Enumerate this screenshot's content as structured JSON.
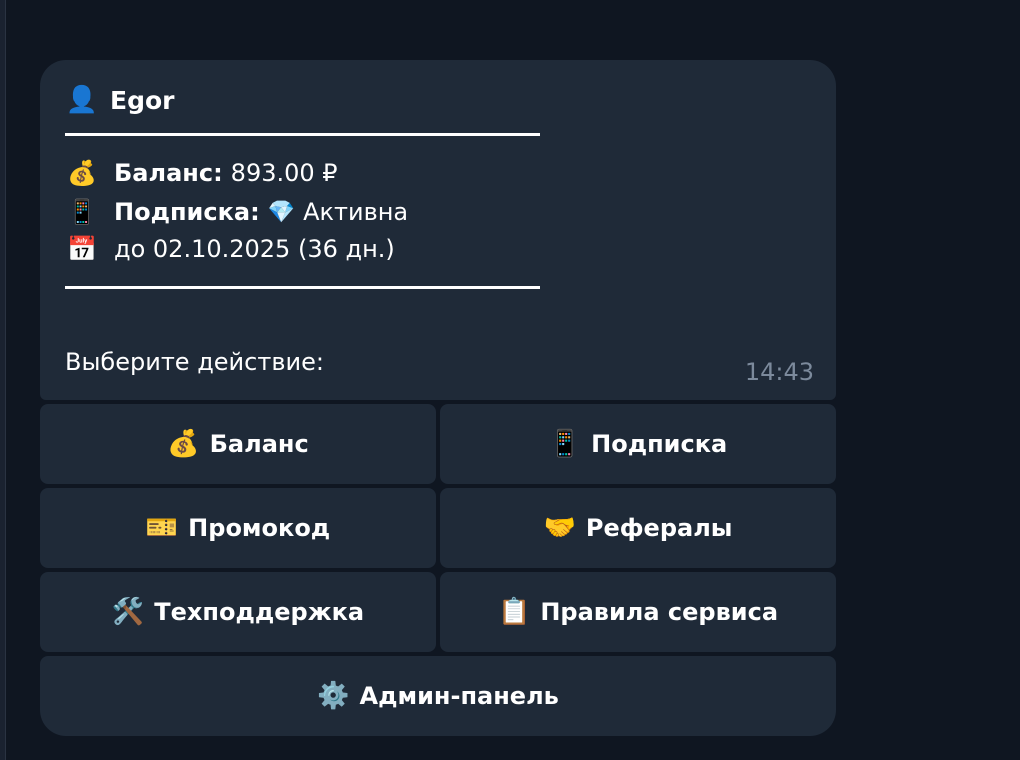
{
  "message": {
    "sender_icon": "👤",
    "sender_name": "Egor",
    "balance": {
      "icon": "💰",
      "label": "Баланс:",
      "value": "893.00 ₽"
    },
    "subscription": {
      "icon": "📱",
      "label": "Подписка:",
      "status_icon": "💎",
      "status": "Активна"
    },
    "expiry": {
      "icon": "📅",
      "text": "до 02.10.2025 (36 дн.)"
    },
    "prompt": "Выберите действие:",
    "time": "14:43"
  },
  "keyboard": [
    {
      "icon": "💰",
      "label": "Баланс"
    },
    {
      "icon": "📱",
      "label": "Подписка"
    },
    {
      "icon": "🎫",
      "label": "Промокод"
    },
    {
      "icon": "🤝",
      "label": "Рефералы"
    },
    {
      "icon": "🛠️",
      "label": "Техподдержка"
    },
    {
      "icon": "📋",
      "label": "Правила сервиса"
    },
    {
      "icon": "⚙️",
      "label": "Админ-панель"
    }
  ],
  "colors": {
    "background": "#0f1621",
    "bubble": "#1f2a38",
    "text": "#ffffff",
    "time": "#7c8a9c"
  }
}
